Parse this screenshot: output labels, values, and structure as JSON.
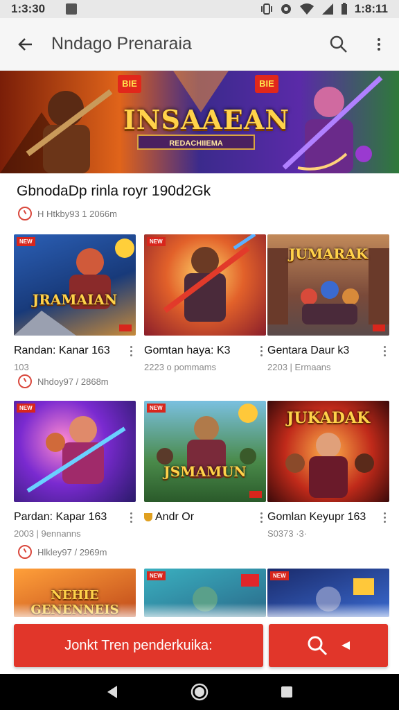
{
  "status_bar": {
    "time": "1:3:30",
    "clock_right": "1:8:11"
  },
  "app_bar": {
    "title": "Nndago Prenaraia"
  },
  "hero": {
    "title": "INSAAEAN",
    "subtitle": "REDACHIIEMA",
    "badge_left": "BIE",
    "badge_right": "BIE"
  },
  "section": {
    "title": "GbnodaDp rinla royr 190d2Gk",
    "meta": "H Htkby93 1 2066m"
  },
  "games": [
    {
      "logo": "JRAMAIAN",
      "title": "Randan: Kanar 163",
      "subtitle": "103",
      "menu": true
    },
    {
      "logo": "",
      "title": "Gomtan haya: K3",
      "subtitle": "2223 o pommams",
      "menu": true
    },
    {
      "logo": "JUMARAK",
      "title": "Gentara Daur k3",
      "subtitle": "2203 | Ermaans",
      "menu": true
    },
    {
      "logo": "",
      "title": "Pardan: Kapar 163",
      "subtitle": "2003 | 9ennanns",
      "menu": true
    },
    {
      "logo": "JSMAMUN",
      "title": "Andr Or",
      "subtitle": "",
      "menu": true
    },
    {
      "logo": "JUKADAK",
      "title": "Gomlan Keyupr 163",
      "subtitle": "S0373 ·3·",
      "menu": true
    },
    {
      "logo": "NEHIE GENENNEIS",
      "title": "",
      "subtitle": "",
      "menu": false
    },
    {
      "logo": "",
      "title": "",
      "subtitle": "",
      "menu": false
    },
    {
      "logo": "",
      "title": "",
      "subtitle": "",
      "menu": false
    }
  ],
  "row_meta": [
    "Nhdoy97 / 2868m",
    "Hlkley97 / 2969m"
  ],
  "actions": {
    "primary_label": "Jonkt Tren penderkuika:"
  },
  "colors": {
    "accent": "#e1362a",
    "status_bar": "#e8e8e8",
    "app_bar": "#f6f6f6",
    "nav_bar": "#000000"
  }
}
